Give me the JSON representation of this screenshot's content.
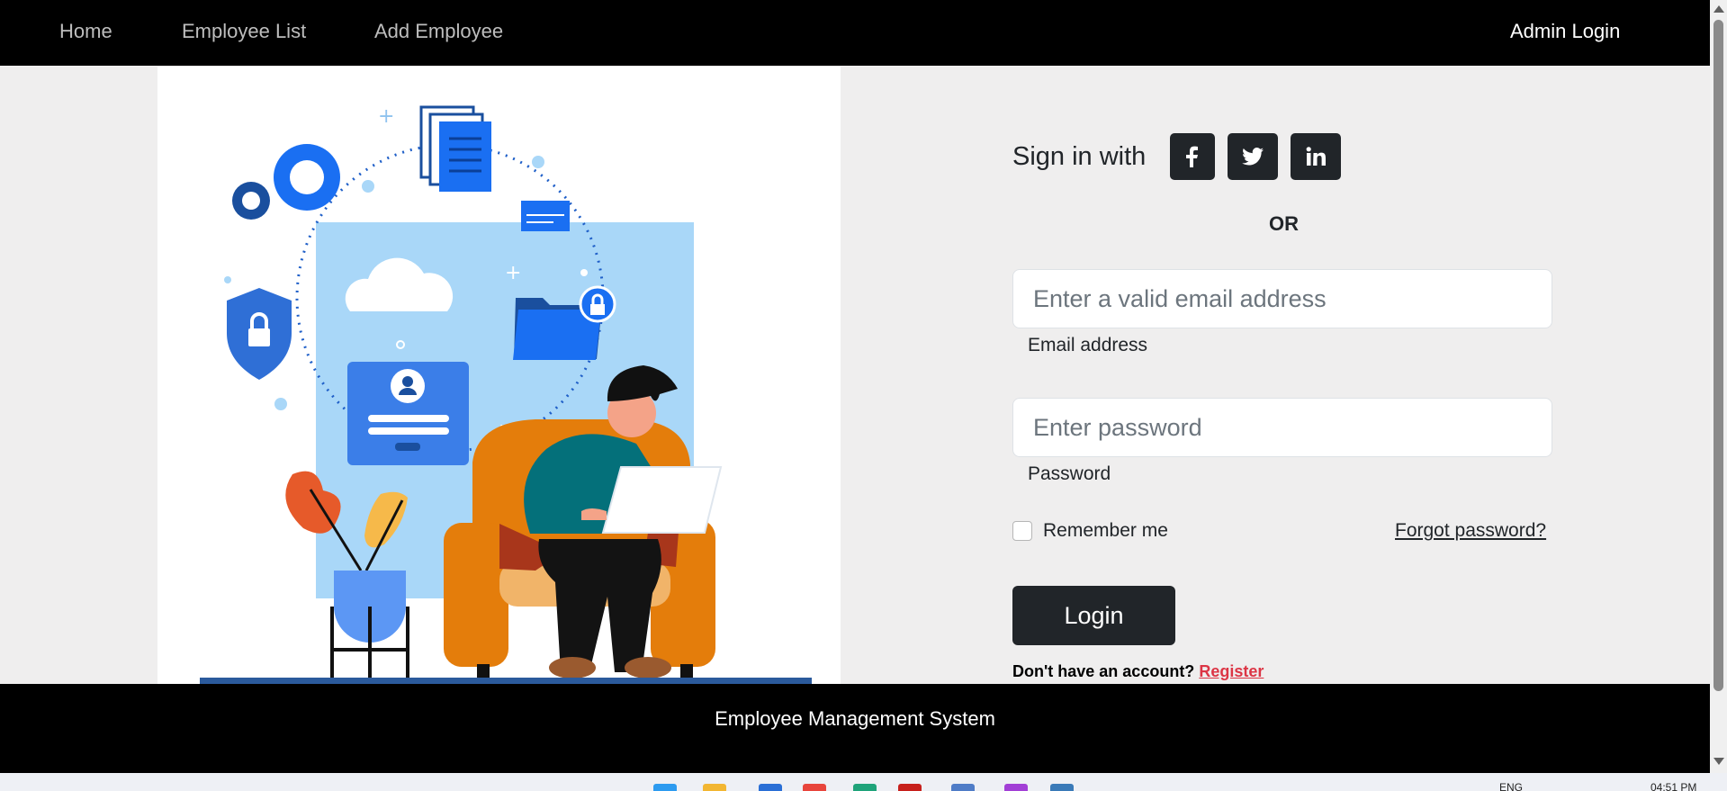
{
  "nav": {
    "home": "Home",
    "employee_list": "Employee List",
    "add_employee": "Add Employee",
    "admin_login": "Admin Login"
  },
  "form": {
    "signin_label": "Sign in with",
    "social": [
      {
        "icon": "facebook-icon",
        "glyph": "f"
      },
      {
        "icon": "twitter-icon",
        "glyph": "twitter"
      },
      {
        "icon": "linkedin-icon",
        "glyph": "in"
      }
    ],
    "or_text": "OR",
    "email_placeholder": "Enter a valid email address",
    "email_label": "Email address",
    "password_placeholder": "Enter password",
    "password_label": "Password",
    "remember_label": "Remember me",
    "remember_checked": false,
    "forgot_link": "Forgot password?",
    "login_button": "Login",
    "register_prompt": "Don't have an account?",
    "register_link": "Register"
  },
  "footer": {
    "text": "Employee Management System"
  },
  "taskbar": {
    "language": "ENG",
    "time": "04:51 PM"
  },
  "colors": {
    "navbar": "#000000",
    "page_bg": "#efeeee",
    "button_dark": "#212529",
    "register_red": "#dc3545",
    "illustration_blue": "#1a6ff2"
  }
}
